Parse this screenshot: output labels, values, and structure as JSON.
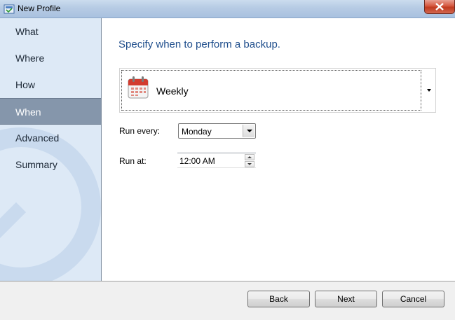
{
  "window": {
    "title": "New Profile"
  },
  "sidebar": {
    "items": [
      {
        "label": "What",
        "active": false
      },
      {
        "label": "Where",
        "active": false
      },
      {
        "label": "How",
        "active": false
      },
      {
        "label": "When",
        "active": true
      },
      {
        "label": "Advanced",
        "active": false
      },
      {
        "label": "Summary",
        "active": false
      }
    ]
  },
  "main": {
    "heading": "Specify when to perform a backup.",
    "schedule": {
      "selected": "Weekly",
      "icon": "calendar-icon"
    },
    "run_every": {
      "label": "Run every:",
      "value": "Monday"
    },
    "run_at": {
      "label": "Run at:",
      "value": "12:00 AM"
    }
  },
  "footer": {
    "back_label": "Back",
    "next_label": "Next",
    "cancel_label": "Cancel"
  },
  "colors": {
    "sidebar_bg": "#dde9f6",
    "active_item_bg": "#8596ab",
    "heading": "#1f4e8c"
  }
}
